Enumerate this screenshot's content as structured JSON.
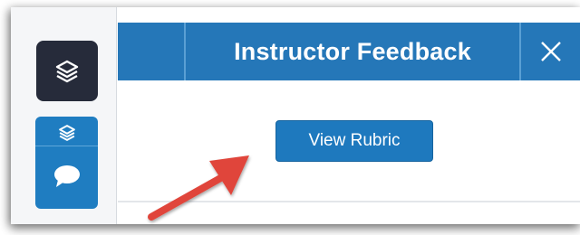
{
  "panel": {
    "title": "Instructor Feedback",
    "view_rubric_label": "View Rubric"
  },
  "icons": {
    "dark_button": "layers-icon",
    "blue_button_top": "layers-icon",
    "blue_button_bottom": "chat-bubble-icon",
    "close": "close-icon",
    "annotation": "red-arrow-icon"
  },
  "colors": {
    "header_blue": "#2577b8",
    "button_blue": "#1e79be",
    "dark_button": "#262b3a",
    "arrow_red": "#e0453a"
  }
}
